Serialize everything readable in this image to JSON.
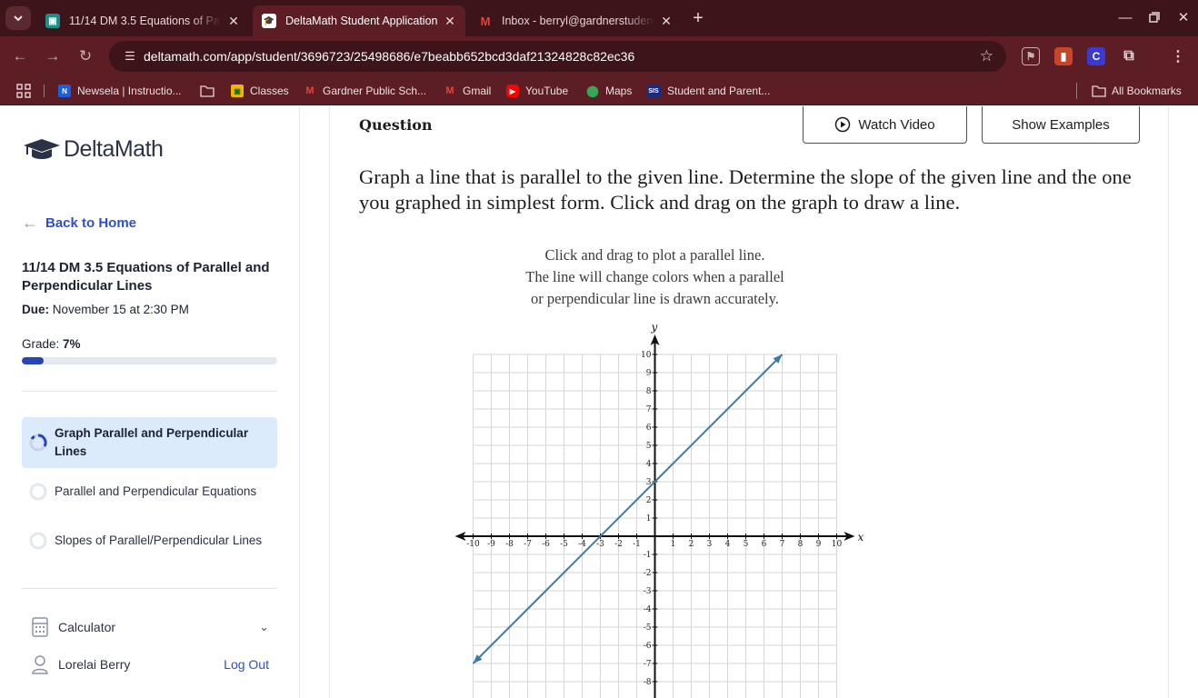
{
  "browser": {
    "tabs": [
      {
        "title": "11/14 DM 3.5 Equations of Pa",
        "icon": "classroom-icon",
        "active": false
      },
      {
        "title": "DeltaMath Student Application",
        "icon": "deltamath-icon",
        "active": true
      },
      {
        "title": "Inbox - berryl@gardnerstudents",
        "icon": "gmail-icon",
        "active": false
      }
    ],
    "url": "deltamath.com/app/student/3696723/25498686/e7beabb652bcd3daf21324828c82ec36",
    "bookmarks": [
      {
        "label": "Newsela | Instructio...",
        "icon": "newsela-icon"
      },
      {
        "label": "",
        "icon": "folder-icon"
      },
      {
        "label": "Classes",
        "icon": "classroom-icon"
      },
      {
        "label": "Gardner Public Sch...",
        "icon": "gmail-icon"
      },
      {
        "label": "Gmail",
        "icon": "gmail-icon"
      },
      {
        "label": "YouTube",
        "icon": "youtube-icon"
      },
      {
        "label": "Maps",
        "icon": "maps-icon"
      },
      {
        "label": "Student and Parent...",
        "icon": "sis-icon"
      }
    ],
    "all_bookmarks": "All Bookmarks",
    "colors": {
      "frame": "#3c1419",
      "toolbar": "#5c1d25"
    }
  },
  "sidebar": {
    "logo": "DeltaMath",
    "back_link": "Back to Home",
    "assignment_title": "11/14 DM 3.5 Equations of Parallel and Perpendicular Lines",
    "due_label": "Due:",
    "due_value": "November 15 at 2:30 PM",
    "grade_label": "Grade:",
    "grade_value": "7%",
    "grade_fraction": 0.07,
    "skills": [
      {
        "label": "Graph Parallel and Perpendicular Lines",
        "active": true
      },
      {
        "label": "Parallel and Perpendicular Equations",
        "active": false
      },
      {
        "label": "Slopes of Parallel/Perpendicular Lines",
        "active": false
      }
    ],
    "calculator": "Calculator",
    "user_name": "Lorelai Berry",
    "logout": "Log Out",
    "colors": {
      "accent": "#2545b8",
      "link": "#2f4fc7",
      "active_skill_bg": "#dcebfb"
    }
  },
  "main": {
    "question_label": "Question",
    "watch_video": "Watch Video",
    "show_examples": "Show Examples",
    "prompt": "Graph a line that is parallel to the given line. Determine the slope of the given line and the one you graphed in simplest form. Click and drag on the graph to draw a line.",
    "instructions": [
      "Click and drag to plot a parallel line.",
      "The line will change colors when a parallel",
      "or perpendicular line is drawn accurately."
    ]
  },
  "graph": {
    "x_axis_label": "x",
    "y_axis_label": "y",
    "x_ticks": [
      -10,
      -9,
      -8,
      -7,
      -6,
      -5,
      -4,
      -3,
      -2,
      -1,
      1,
      2,
      3,
      4,
      5,
      6,
      7,
      8,
      9,
      10
    ],
    "y_ticks": [
      10,
      9,
      8,
      7,
      6,
      5,
      4,
      3,
      2,
      1,
      -1,
      -2,
      -3,
      -4,
      -5,
      -6,
      -7,
      -8
    ],
    "xlim": [
      -10,
      10
    ],
    "ylim": [
      -10,
      10
    ],
    "given_line": {
      "x1": -10,
      "y1": -7,
      "x2": 7,
      "y2": 10,
      "color": "#3d7aa6"
    }
  }
}
